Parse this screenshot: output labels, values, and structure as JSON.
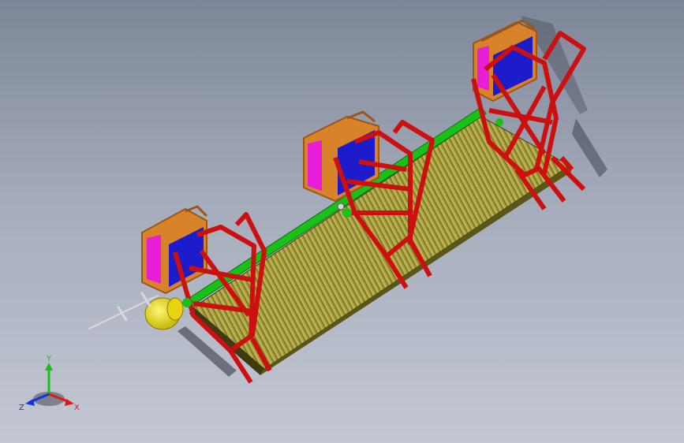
{
  "scene": {
    "background_top": "#7d8698",
    "background_bottom": "#c3c8d3"
  },
  "colors": {
    "frame_red": "#cc1010",
    "frame_red_dark": "#8a0808",
    "hopper_orange": "#d8822a",
    "hopper_orange_dark": "#9c561a",
    "panel_blue": "#1c1ccc",
    "panel_magenta": "#e81ed8",
    "belt_olive": "#a8a040",
    "belt_dark": "#3e3a12",
    "rail_green": "#18c018",
    "motor_yellow": "#f2e21a",
    "shaft_gray": "#d9d9d9",
    "shadow": "#2b2f38"
  },
  "triad": {
    "axis_x": {
      "label": "X",
      "color": "#e01818"
    },
    "axis_y": {
      "label": "Y",
      "color": "#18c018"
    },
    "axis_z": {
      "label": "Z",
      "color": "#1830e0"
    }
  }
}
